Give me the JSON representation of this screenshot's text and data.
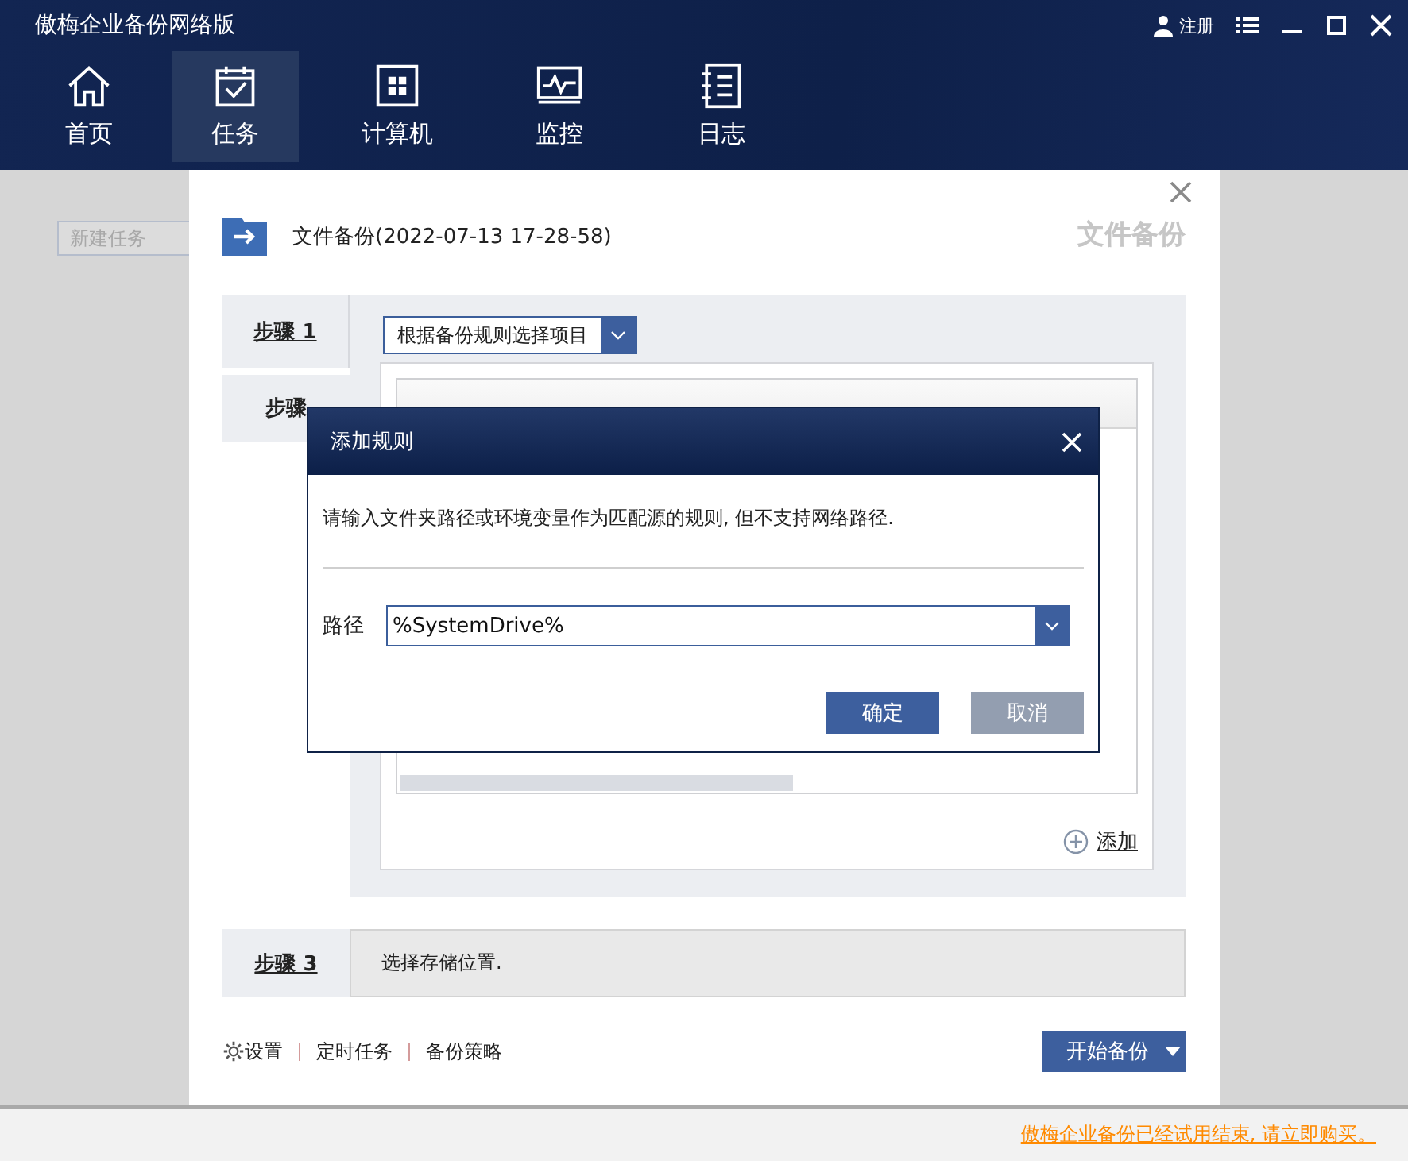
{
  "window": {
    "title": "傲梅企业备份网络版",
    "user_label": "注册"
  },
  "nav": [
    {
      "label": "首页",
      "selected": false
    },
    {
      "label": "任务",
      "selected": true
    },
    {
      "label": "计算机",
      "selected": false
    },
    {
      "label": "监控",
      "selected": false
    },
    {
      "label": "日志",
      "selected": false
    }
  ],
  "sidebar": {
    "new_task": "新建任务"
  },
  "task": {
    "title": "文件备份(2022-07-13 17-28-58)",
    "type_label": "文件备份"
  },
  "steps": [
    {
      "label": "步骤 1",
      "dropdown": "根据备份规则选择项目",
      "add_link": "添加"
    },
    {
      "label": "步骤"
    },
    {
      "label": "步骤 3",
      "description": "选择存储位置."
    }
  ],
  "footer": {
    "links": [
      "设置",
      "定时任务",
      "备份策略"
    ],
    "start_button": "开始备份"
  },
  "dialog": {
    "title": "添加规则",
    "message": "请输入文件夹路径或环境变量作为匹配源的规则, 但不支持网络路径.",
    "path_label": "路径",
    "path_value": "%SystemDrive%",
    "buttons": [
      {
        "label": "确定",
        "kind": "primary"
      },
      {
        "label": "取消",
        "kind": "secondary"
      }
    ]
  },
  "status_bar": {
    "notice": "傲梅企业备份已经试用结束, 请立即购买。"
  }
}
